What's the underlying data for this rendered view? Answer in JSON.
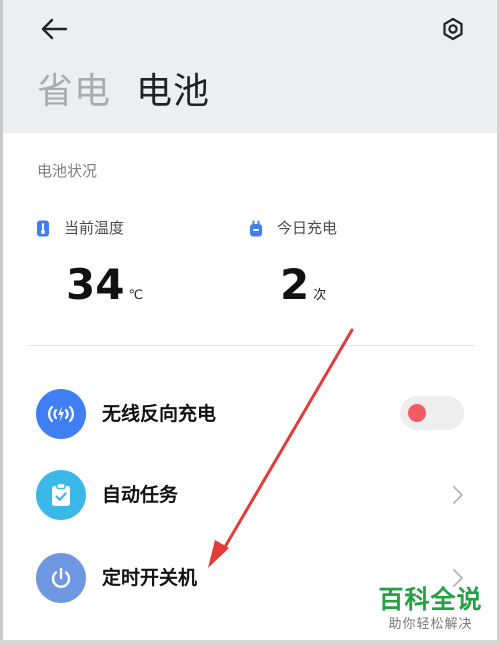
{
  "header": {
    "tabs": [
      {
        "label": "省电",
        "active": false
      },
      {
        "label": "电池",
        "active": true
      }
    ]
  },
  "battery_status": {
    "title": "电池状况",
    "temperature": {
      "label": "当前温度",
      "value": "34",
      "unit": "℃"
    },
    "charges_today": {
      "label": "今日充电",
      "value": "2",
      "unit": "次"
    }
  },
  "settings": [
    {
      "label": "无线反向充电",
      "control": "toggle",
      "toggle_on": false,
      "icon": "wireless-charge-icon"
    },
    {
      "label": "自动任务",
      "control": "chevron",
      "icon": "clipboard-check-icon"
    },
    {
      "label": "定时开关机",
      "control": "chevron",
      "icon": "power-icon"
    }
  ],
  "watermark": {
    "title": "百科全说",
    "subtitle": "助你轻松解决"
  },
  "colors": {
    "header_bg": "#eceef0",
    "wireless_icon": "#3f7ff3",
    "auto_task_icon": "#3ab9e8",
    "schedule_icon": "#6e97e2",
    "toggle_knob": "#f25c63",
    "annotation_arrow": "#e53a3a",
    "watermark": "#23a043"
  }
}
